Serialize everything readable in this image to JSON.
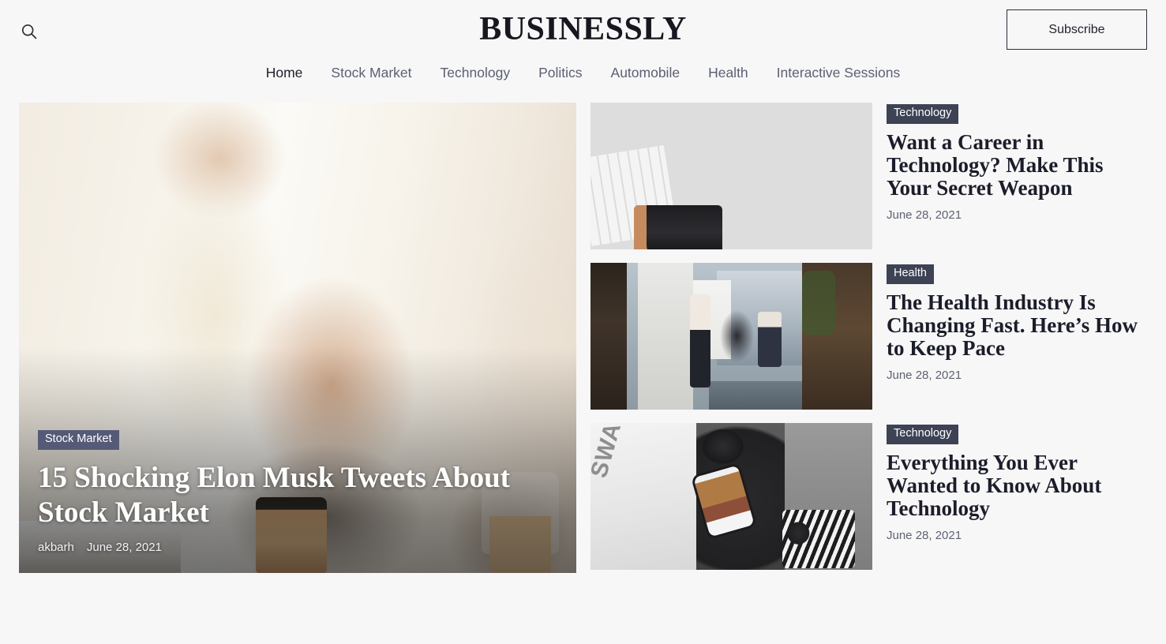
{
  "header": {
    "brand": "BUSINESSLY",
    "search_icon": "search-icon",
    "subscribe_label": "Subscribe",
    "nav": [
      {
        "label": "Home",
        "active": true
      },
      {
        "label": "Stock Market",
        "active": false
      },
      {
        "label": "Technology",
        "active": false
      },
      {
        "label": "Politics",
        "active": false
      },
      {
        "label": "Automobile",
        "active": false
      },
      {
        "label": "Health",
        "active": false
      },
      {
        "label": "Interactive Sessions",
        "active": false
      }
    ]
  },
  "hero": {
    "category": "Stock Market",
    "title": "15 Shocking Elon Musk Tweets About Stock Market",
    "author": "akbarh",
    "date": "June 28, 2021",
    "image_alt": "two-people-shaking-hands-over-desk"
  },
  "stories": [
    {
      "category": "Technology",
      "title": "Want a Career in Technology? Make This Your Secret Weapon",
      "date": "June 28, 2021",
      "image_alt": "desk-flat-lay-keyboard-mouse-tablet-camera"
    },
    {
      "category": "Health",
      "title": "The Health Industry Is Changing Fast. Here’s How to Keep Pace",
      "date": "June 28, 2021",
      "image_alt": "office-meeting-through-doorway"
    },
    {
      "category": "Technology",
      "title": "Everything You Ever Wanted to Know About Technology",
      "date": "June 28, 2021",
      "image_alt": "swagger-magazine-phone-headphones-on-dark-table",
      "magazine_word": "SWAGGER"
    }
  ],
  "colors": {
    "page_background": "#f7f7f7",
    "text_primary": "#1b1d2a",
    "text_muted": "#5f6372",
    "badge_hero": "#555a77",
    "badge_dark": "#3d4254"
  }
}
